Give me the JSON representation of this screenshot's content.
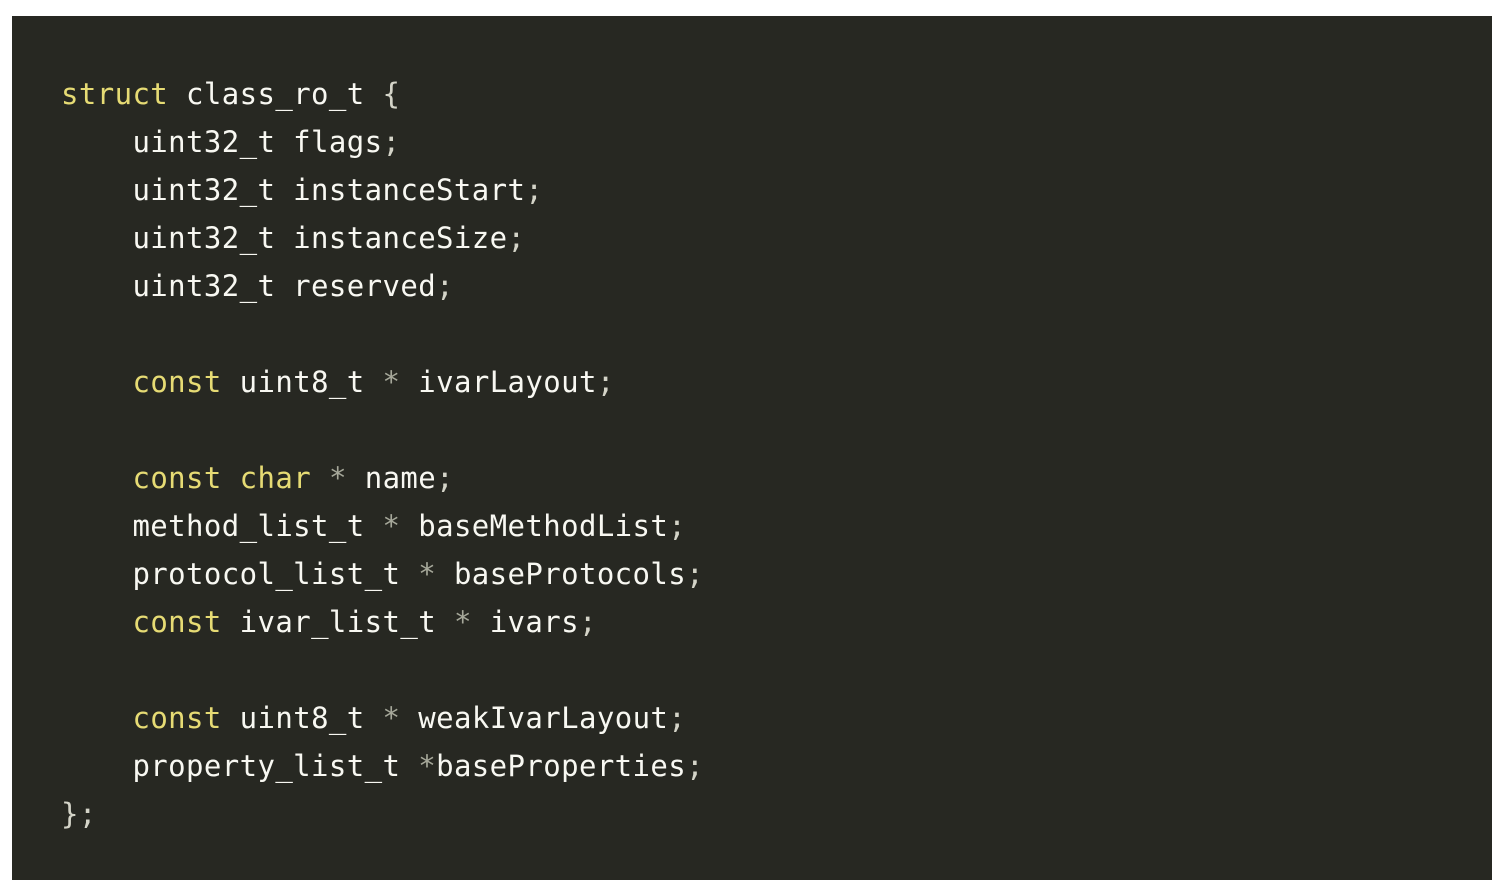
{
  "colors": {
    "background": "#272822",
    "keyword": "#e6db74",
    "plain": "#f8f8f2",
    "punctuation": "#d4d4c8",
    "operator": "#a6a89a"
  },
  "code": {
    "lines": [
      [
        {
          "t": "struct",
          "k": "keyword"
        },
        {
          "t": " class_ro_t ",
          "k": "plain"
        },
        {
          "t": "{",
          "k": "punctuation"
        }
      ],
      [
        {
          "t": "    uint32_t flags",
          "k": "plain"
        },
        {
          "t": ";",
          "k": "punctuation"
        }
      ],
      [
        {
          "t": "    uint32_t instanceStart",
          "k": "plain"
        },
        {
          "t": ";",
          "k": "punctuation"
        }
      ],
      [
        {
          "t": "    uint32_t instanceSize",
          "k": "plain"
        },
        {
          "t": ";",
          "k": "punctuation"
        }
      ],
      [
        {
          "t": "    uint32_t reserved",
          "k": "plain"
        },
        {
          "t": ";",
          "k": "punctuation"
        }
      ],
      [],
      [
        {
          "t": "    ",
          "k": "plain"
        },
        {
          "t": "const",
          "k": "keyword"
        },
        {
          "t": " uint8_t ",
          "k": "plain"
        },
        {
          "t": "*",
          "k": "operator"
        },
        {
          "t": " ivarLayout",
          "k": "plain"
        },
        {
          "t": ";",
          "k": "punctuation"
        }
      ],
      [],
      [
        {
          "t": "    ",
          "k": "plain"
        },
        {
          "t": "const",
          "k": "keyword"
        },
        {
          "t": " ",
          "k": "plain"
        },
        {
          "t": "char",
          "k": "keyword"
        },
        {
          "t": " ",
          "k": "plain"
        },
        {
          "t": "*",
          "k": "operator"
        },
        {
          "t": " name",
          "k": "plain"
        },
        {
          "t": ";",
          "k": "punctuation"
        }
      ],
      [
        {
          "t": "    method_list_t ",
          "k": "plain"
        },
        {
          "t": "*",
          "k": "operator"
        },
        {
          "t": " baseMethodList",
          "k": "plain"
        },
        {
          "t": ";",
          "k": "punctuation"
        }
      ],
      [
        {
          "t": "    protocol_list_t ",
          "k": "plain"
        },
        {
          "t": "*",
          "k": "operator"
        },
        {
          "t": " baseProtocols",
          "k": "plain"
        },
        {
          "t": ";",
          "k": "punctuation"
        }
      ],
      [
        {
          "t": "    ",
          "k": "plain"
        },
        {
          "t": "const",
          "k": "keyword"
        },
        {
          "t": " ivar_list_t ",
          "k": "plain"
        },
        {
          "t": "*",
          "k": "operator"
        },
        {
          "t": " ivars",
          "k": "plain"
        },
        {
          "t": ";",
          "k": "punctuation"
        }
      ],
      [],
      [
        {
          "t": "    ",
          "k": "plain"
        },
        {
          "t": "const",
          "k": "keyword"
        },
        {
          "t": " uint8_t ",
          "k": "plain"
        },
        {
          "t": "*",
          "k": "operator"
        },
        {
          "t": " weakIvarLayout",
          "k": "plain"
        },
        {
          "t": ";",
          "k": "punctuation"
        }
      ],
      [
        {
          "t": "    property_list_t ",
          "k": "plain"
        },
        {
          "t": "*",
          "k": "operator"
        },
        {
          "t": "baseProperties",
          "k": "plain"
        },
        {
          "t": ";",
          "k": "punctuation"
        }
      ],
      [
        {
          "t": "}",
          "k": "punctuation"
        },
        {
          "t": ";",
          "k": "punctuation"
        }
      ]
    ]
  }
}
